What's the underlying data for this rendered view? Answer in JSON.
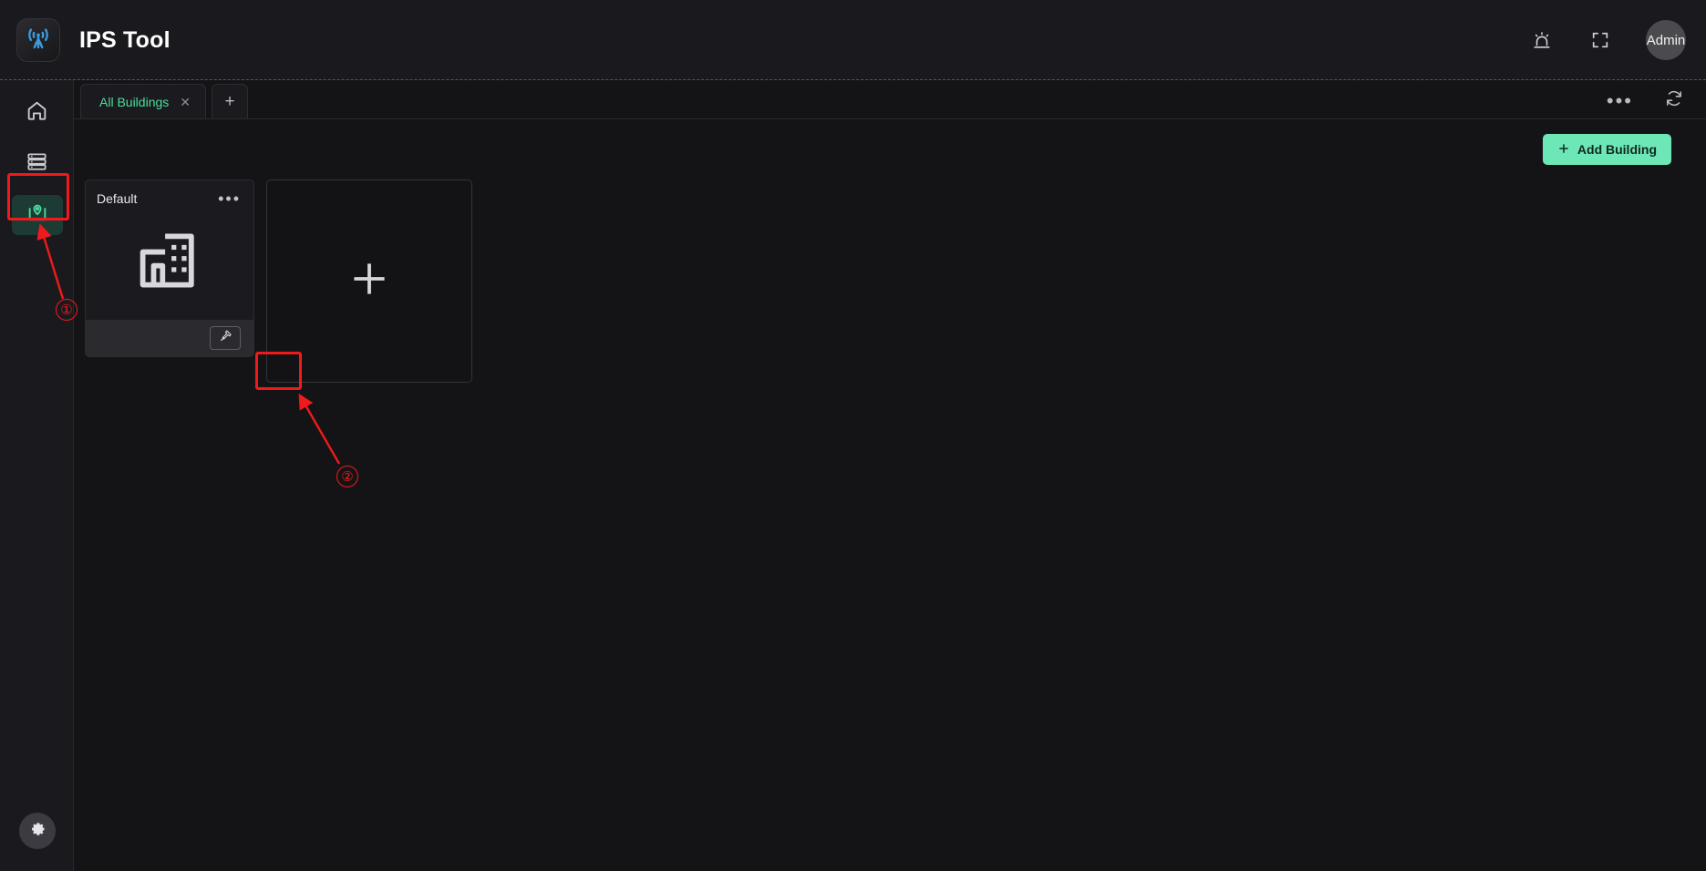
{
  "app": {
    "title": "IPS Tool",
    "logo_icon": "antenna-tower-icon"
  },
  "header": {
    "alarm_icon": "alarm-beacon-icon",
    "fullscreen_icon": "fullscreen-icon",
    "avatar_label": "Admin"
  },
  "sidebar": {
    "items": [
      {
        "name": "home",
        "icon": "home-icon",
        "active": false
      },
      {
        "name": "devices",
        "icon": "server-stack-icon",
        "active": false
      },
      {
        "name": "buildings",
        "icon": "map-pin-location-icon",
        "active": true
      }
    ],
    "settings_icon": "gear-icon"
  },
  "tabbar": {
    "tabs": [
      {
        "label": "All Buildings",
        "close_icon": "close-icon"
      }
    ],
    "add_tab_label": "+",
    "more_label": "•••",
    "refresh_icon": "refresh-icon"
  },
  "main": {
    "add_building_button": {
      "label": "Add Building",
      "plus_icon": "plus-icon"
    },
    "cards": [
      {
        "title": "Default",
        "more_label": "•••",
        "thumb_icon": "building-icon",
        "tool_icon": "hammer-tool-icon"
      }
    ],
    "add_card": {
      "plus_icon": "plus-icon"
    }
  },
  "annotations": [
    {
      "number": "①",
      "target": "sidebar-item-buildings"
    },
    {
      "number": "②",
      "target": "card-tool-button"
    }
  ],
  "colors": {
    "accent_green": "#6ee7b7",
    "tab_active_text": "#4ade9b",
    "annotation_red": "#f01a1a",
    "logo_blue": "#3b9cdb",
    "sidebar_active_bg": "#1d3b35"
  }
}
